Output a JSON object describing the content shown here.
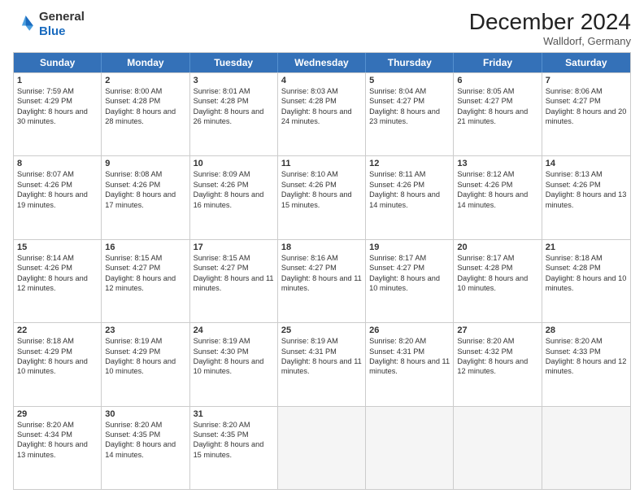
{
  "logo": {
    "general": "General",
    "blue": "Blue"
  },
  "header": {
    "month": "December 2024",
    "location": "Walldorf, Germany"
  },
  "days": [
    "Sunday",
    "Monday",
    "Tuesday",
    "Wednesday",
    "Thursday",
    "Friday",
    "Saturday"
  ],
  "rows": [
    [
      {
        "day": "1",
        "rise": "7:59 AM",
        "set": "4:29 PM",
        "daylight": "8 hours and 30 minutes."
      },
      {
        "day": "2",
        "rise": "8:00 AM",
        "set": "4:28 PM",
        "daylight": "8 hours and 28 minutes."
      },
      {
        "day": "3",
        "rise": "8:01 AM",
        "set": "4:28 PM",
        "daylight": "8 hours and 26 minutes."
      },
      {
        "day": "4",
        "rise": "8:03 AM",
        "set": "4:28 PM",
        "daylight": "8 hours and 24 minutes."
      },
      {
        "day": "5",
        "rise": "8:04 AM",
        "set": "4:27 PM",
        "daylight": "8 hours and 23 minutes."
      },
      {
        "day": "6",
        "rise": "8:05 AM",
        "set": "4:27 PM",
        "daylight": "8 hours and 21 minutes."
      },
      {
        "day": "7",
        "rise": "8:06 AM",
        "set": "4:27 PM",
        "daylight": "8 hours and 20 minutes."
      }
    ],
    [
      {
        "day": "8",
        "rise": "8:07 AM",
        "set": "4:26 PM",
        "daylight": "8 hours and 19 minutes."
      },
      {
        "day": "9",
        "rise": "8:08 AM",
        "set": "4:26 PM",
        "daylight": "8 hours and 17 minutes."
      },
      {
        "day": "10",
        "rise": "8:09 AM",
        "set": "4:26 PM",
        "daylight": "8 hours and 16 minutes."
      },
      {
        "day": "11",
        "rise": "8:10 AM",
        "set": "4:26 PM",
        "daylight": "8 hours and 15 minutes."
      },
      {
        "day": "12",
        "rise": "8:11 AM",
        "set": "4:26 PM",
        "daylight": "8 hours and 14 minutes."
      },
      {
        "day": "13",
        "rise": "8:12 AM",
        "set": "4:26 PM",
        "daylight": "8 hours and 14 minutes."
      },
      {
        "day": "14",
        "rise": "8:13 AM",
        "set": "4:26 PM",
        "daylight": "8 hours and 13 minutes."
      }
    ],
    [
      {
        "day": "15",
        "rise": "8:14 AM",
        "set": "4:26 PM",
        "daylight": "8 hours and 12 minutes."
      },
      {
        "day": "16",
        "rise": "8:15 AM",
        "set": "4:27 PM",
        "daylight": "8 hours and 12 minutes."
      },
      {
        "day": "17",
        "rise": "8:15 AM",
        "set": "4:27 PM",
        "daylight": "8 hours and 11 minutes."
      },
      {
        "day": "18",
        "rise": "8:16 AM",
        "set": "4:27 PM",
        "daylight": "8 hours and 11 minutes."
      },
      {
        "day": "19",
        "rise": "8:17 AM",
        "set": "4:27 PM",
        "daylight": "8 hours and 10 minutes."
      },
      {
        "day": "20",
        "rise": "8:17 AM",
        "set": "4:28 PM",
        "daylight": "8 hours and 10 minutes."
      },
      {
        "day": "21",
        "rise": "8:18 AM",
        "set": "4:28 PM",
        "daylight": "8 hours and 10 minutes."
      }
    ],
    [
      {
        "day": "22",
        "rise": "8:18 AM",
        "set": "4:29 PM",
        "daylight": "8 hours and 10 minutes."
      },
      {
        "day": "23",
        "rise": "8:19 AM",
        "set": "4:29 PM",
        "daylight": "8 hours and 10 minutes."
      },
      {
        "day": "24",
        "rise": "8:19 AM",
        "set": "4:30 PM",
        "daylight": "8 hours and 10 minutes."
      },
      {
        "day": "25",
        "rise": "8:19 AM",
        "set": "4:31 PM",
        "daylight": "8 hours and 11 minutes."
      },
      {
        "day": "26",
        "rise": "8:20 AM",
        "set": "4:31 PM",
        "daylight": "8 hours and 11 minutes."
      },
      {
        "day": "27",
        "rise": "8:20 AM",
        "set": "4:32 PM",
        "daylight": "8 hours and 12 minutes."
      },
      {
        "day": "28",
        "rise": "8:20 AM",
        "set": "4:33 PM",
        "daylight": "8 hours and 12 minutes."
      }
    ],
    [
      {
        "day": "29",
        "rise": "8:20 AM",
        "set": "4:34 PM",
        "daylight": "8 hours and 13 minutes."
      },
      {
        "day": "30",
        "rise": "8:20 AM",
        "set": "4:35 PM",
        "daylight": "8 hours and 14 minutes."
      },
      {
        "day": "31",
        "rise": "8:20 AM",
        "set": "4:35 PM",
        "daylight": "8 hours and 15 minutes."
      },
      null,
      null,
      null,
      null
    ]
  ]
}
